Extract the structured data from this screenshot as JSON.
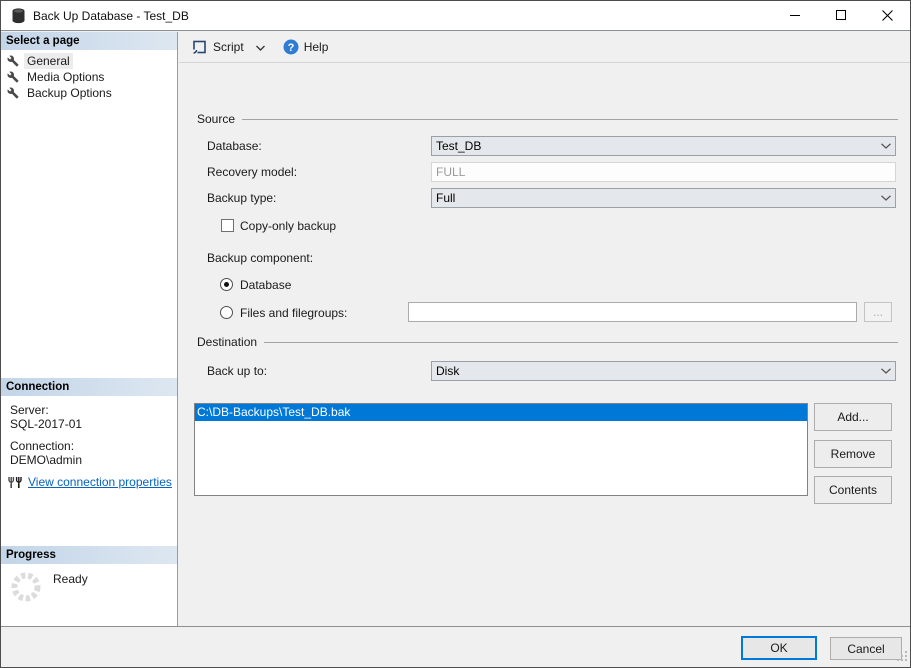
{
  "window": {
    "title": "Back Up Database - Test_DB"
  },
  "sidebar": {
    "pages": {
      "header": "Select a page",
      "items": [
        {
          "label": "General",
          "selected": true
        },
        {
          "label": "Media Options",
          "selected": false
        },
        {
          "label": "Backup Options",
          "selected": false
        }
      ]
    },
    "connection": {
      "header": "Connection",
      "server_label": "Server:",
      "server_value": "SQL-2017-01",
      "connection_label": "Connection:",
      "connection_value": "DEMO\\admin",
      "link_label": "View connection properties"
    },
    "progress": {
      "header": "Progress",
      "status": "Ready"
    }
  },
  "toolbar": {
    "script_label": "Script",
    "help_label": "Help"
  },
  "form": {
    "source": {
      "group_label": "Source",
      "database_label": "Database:",
      "database_value": "Test_DB",
      "recovery_label": "Recovery model:",
      "recovery_value": "FULL",
      "backup_type_label": "Backup type:",
      "backup_type_value": "Full",
      "copy_only_label": "Copy-only backup",
      "component_label": "Backup component:",
      "radio_database_label": "Database",
      "radio_files_label": "Files and filegroups:",
      "files_value": "",
      "browse_label": "..."
    },
    "destination": {
      "group_label": "Destination",
      "backup_to_label": "Back up to:",
      "backup_to_value": "Disk",
      "paths": [
        {
          "text": "C:\\DB-Backups\\Test_DB.bak"
        }
      ],
      "add_label": "Add...",
      "remove_label": "Remove",
      "contents_label": "Contents"
    }
  },
  "footer": {
    "ok_label": "OK",
    "cancel_label": "Cancel"
  },
  "colors": {
    "selection_blue": "#0078d7",
    "link_blue": "#0563c1",
    "header_blue_start": "#c3d5e8",
    "header_blue_end": "#dde7f1",
    "help_icon_blue": "#2f7cd3"
  }
}
